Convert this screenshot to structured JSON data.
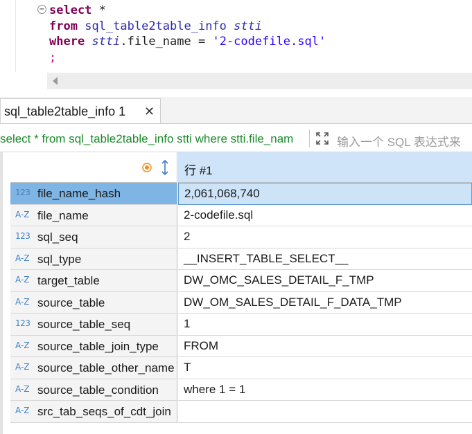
{
  "editor": {
    "lines": [
      [
        {
          "t": "select",
          "c": "kw"
        },
        {
          "t": " *",
          "c": "plain"
        }
      ],
      [
        {
          "t": "from",
          "c": "kw"
        },
        {
          "t": " ",
          "c": "plain"
        },
        {
          "t": "sql_table2table_info",
          "c": "tbl"
        },
        {
          "t": " ",
          "c": "plain"
        },
        {
          "t": "stti",
          "c": "alias"
        }
      ],
      [
        {
          "t": "where",
          "c": "kw"
        },
        {
          "t": " ",
          "c": "plain"
        },
        {
          "t": "stti",
          "c": "alias"
        },
        {
          "t": ".file_name = ",
          "c": "plain"
        },
        {
          "t": "'2-codefile.sql'",
          "c": "str"
        }
      ],
      [
        {
          "t": ";",
          "c": "semi"
        }
      ]
    ],
    "fold_glyph": "−"
  },
  "tab": {
    "label": "sql_table2table_info 1",
    "close_glyph": "✕"
  },
  "filter": {
    "query_text": "select * from sql_table2table_info stti where stti.file_nam",
    "placeholder": "输入一个 SQL 表达式来"
  },
  "grid": {
    "column_header": "行 #1",
    "rows": [
      {
        "type": "123",
        "name": "file_name_hash",
        "value": "2,061,068,740",
        "selected": true
      },
      {
        "type": "A-Z",
        "name": "file_name",
        "value": "2-codefile.sql",
        "selected": false
      },
      {
        "type": "123",
        "name": "sql_seq",
        "value": "2",
        "selected": false
      },
      {
        "type": "A-Z",
        "name": "sql_type",
        "value": "__INSERT_TABLE_SELECT__",
        "selected": false
      },
      {
        "type": "A-Z",
        "name": "target_table",
        "value": "DW_OMC_SALES_DETAIL_F_TMP",
        "selected": false
      },
      {
        "type": "A-Z",
        "name": "source_table",
        "value": "DW_OM_SALES_DETAIL_F_DATA_TMP",
        "selected": false
      },
      {
        "type": "123",
        "name": "source_table_seq",
        "value": "1",
        "selected": false
      },
      {
        "type": "A-Z",
        "name": "source_table_join_type",
        "value": "FROM",
        "selected": false
      },
      {
        "type": "A-Z",
        "name": "source_table_other_name",
        "value": "T",
        "selected": false
      },
      {
        "type": "A-Z",
        "name": "source_table_condition",
        "value": "where 1 = 1",
        "selected": false
      },
      {
        "type": "A-Z",
        "name": "src_tab_seqs_of_cdt_join",
        "value": "",
        "selected": false
      }
    ]
  },
  "colors": {
    "keyword": "#7f0055",
    "filter_text": "#1b8a2b",
    "header_bg": "#cfe4f8",
    "selected_row": "#7eb5e4",
    "type_icon": "#3f7fc7"
  }
}
